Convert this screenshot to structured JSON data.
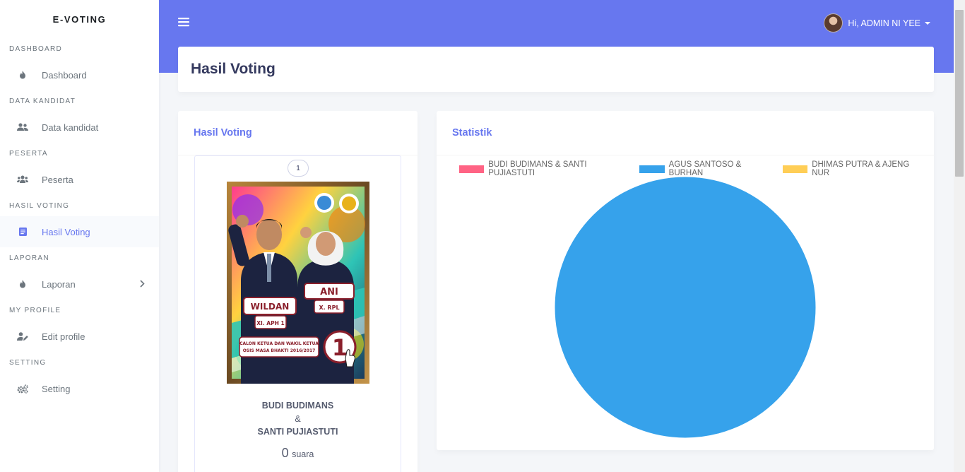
{
  "sidebar": {
    "brand": "E-VOTING",
    "sections": [
      {
        "header": "DASHBOARD",
        "label": "Dashboard",
        "icon": "fire-icon"
      },
      {
        "header": "DATA KANDIDAT",
        "label": "Data kandidat",
        "icon": "users-icon"
      },
      {
        "header": "PESERTA",
        "label": "Peserta",
        "icon": "users-group-icon"
      },
      {
        "header": "HASIL VOTING",
        "label": "Hasil Voting",
        "icon": "document-icon",
        "active": true
      },
      {
        "header": "LAPORAN",
        "label": "Laporan",
        "icon": "fire-icon",
        "has_submenu": true
      },
      {
        "header": "MY PROFILE",
        "label": "Edit profile",
        "icon": "user-edit-icon"
      },
      {
        "header": "SETTING",
        "label": "Setting",
        "icon": "cogs-icon"
      }
    ]
  },
  "topbar": {
    "user_greeting": "Hi, ADMIN NI YEE",
    "accent": "#6777ef"
  },
  "page": {
    "title": "Hasil Voting"
  },
  "results_card": {
    "title": "Hasil Voting",
    "candidate": {
      "number": "1",
      "name_1": "BUDI BUDIMANS",
      "separator": "&",
      "name_2": "SANTI PUJIASTUTI",
      "votes": "0",
      "votes_unit": "suara"
    },
    "poster": {
      "name_left": "WILDAN",
      "class_left": "XI. APH 1",
      "name_right": "ANI",
      "class_right": "X. RPL",
      "caption_line_1": "CALON KETUA DAN WAKIL KETUA",
      "caption_line_2": "OSIS MASA BHAKTI 2016/2017",
      "number": "1"
    }
  },
  "stats_card": {
    "title": "Statistik"
  },
  "chart_data": {
    "type": "pie",
    "legend_position": "top",
    "categories": [
      "BUDI BUDIMANS & SANTI PUJIASTUTI",
      "AGUS SANTOSO & BURHAN",
      "DHIMAS PUTRA & AJENG NUR"
    ],
    "values": [
      0,
      1,
      0
    ],
    "colors": [
      "#ff6384",
      "#36a2eb",
      "#ffce56"
    ]
  }
}
